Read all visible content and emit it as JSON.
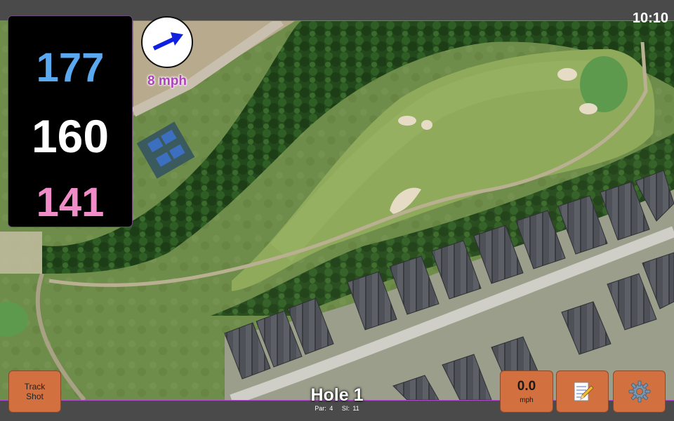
{
  "status": {
    "clock": "10:10"
  },
  "distances": {
    "back": "177",
    "middle": "160",
    "front": "141",
    "colors": {
      "back": "#5aa9f0",
      "middle": "#ffffff",
      "front": "#f08cc8"
    }
  },
  "wind": {
    "label": "8 mph",
    "label_color": "#b040c0",
    "arrow_color": "#1020e0",
    "arrow_icon": "wind-direction-arrow-icon"
  },
  "buttons": {
    "track_shot_line1": "Track",
    "track_shot_line2": "Shot",
    "speed_value": "0.0",
    "speed_unit": "mph",
    "notes_icon": "notepad-pencil-icon",
    "settings_icon": "gear-icon",
    "button_color": "#d2703f"
  },
  "hole": {
    "title": "Hole 1",
    "par": "Par: 4",
    "si": "SI: 11"
  },
  "map": {
    "type": "satellite-aerial-golf-hole"
  }
}
